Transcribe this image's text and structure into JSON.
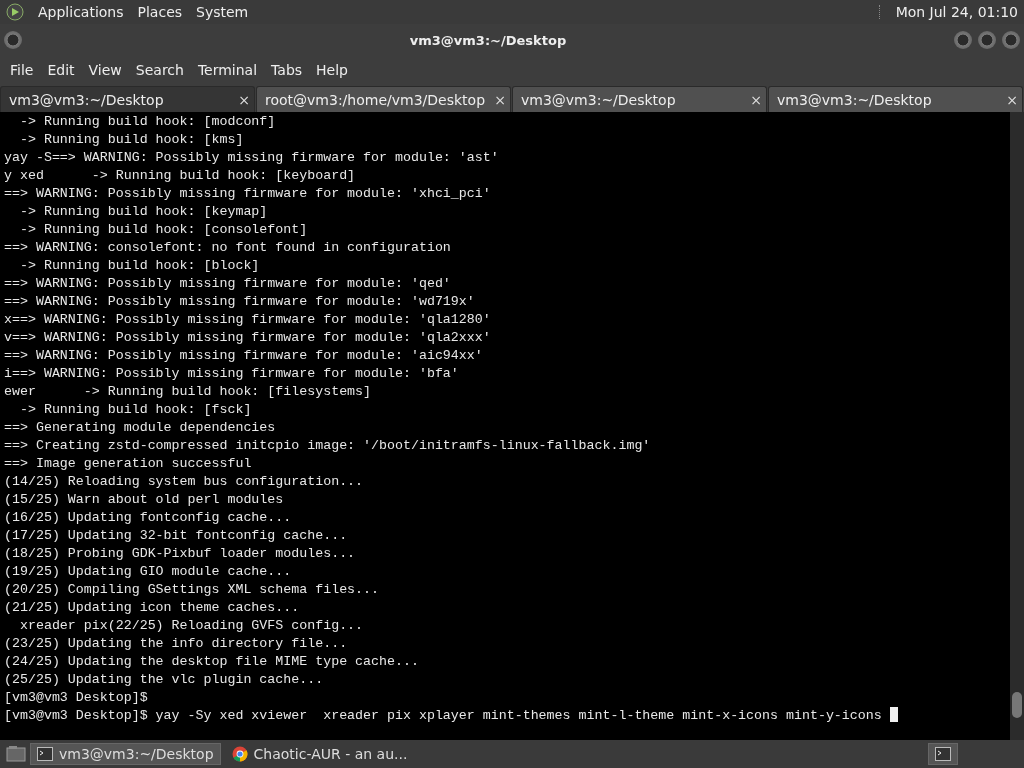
{
  "top_panel": {
    "menus": [
      "Applications",
      "Places",
      "System"
    ],
    "clock": "Mon Jul 24, 01:10"
  },
  "window": {
    "title": "vm3@vm3:~/Desktop"
  },
  "menu_bar": [
    "File",
    "Edit",
    "View",
    "Search",
    "Terminal",
    "Tabs",
    "Help"
  ],
  "tabs": [
    {
      "label": "vm3@vm3:~/Desktop",
      "close": "×",
      "selected": true
    },
    {
      "label": "root@vm3:/home/vm3/Desktop",
      "close": "×",
      "selected": false
    },
    {
      "label": "vm3@vm3:~/Desktop",
      "close": "×",
      "selected": false
    },
    {
      "label": "vm3@vm3:~/Desktop",
      "close": "×",
      "selected": false
    }
  ],
  "terminal": {
    "lines": [
      "  -> Running build hook: [modconf]",
      "  -> Running build hook: [kms]",
      "yay -S==> WARNING: Possibly missing firmware for module: 'ast'",
      "y xed      -> Running build hook: [keyboard]",
      "==> WARNING: Possibly missing firmware for module: 'xhci_pci'",
      "  -> Running build hook: [keymap]",
      "  -> Running build hook: [consolefont]",
      "==> WARNING: consolefont: no font found in configuration",
      "  -> Running build hook: [block]",
      "==> WARNING: Possibly missing firmware for module: 'qed'",
      "==> WARNING: Possibly missing firmware for module: 'wd719x'",
      "x==> WARNING: Possibly missing firmware for module: 'qla1280'",
      "v==> WARNING: Possibly missing firmware for module: 'qla2xxx'",
      "==> WARNING: Possibly missing firmware for module: 'aic94xx'",
      "i==> WARNING: Possibly missing firmware for module: 'bfa'",
      "ewer      -> Running build hook: [filesystems]",
      "  -> Running build hook: [fsck]",
      "==> Generating module dependencies",
      "==> Creating zstd-compressed initcpio image: '/boot/initramfs-linux-fallback.img'",
      "==> Image generation successful",
      "(14/25) Reloading system bus configuration...",
      "(15/25) Warn about old perl modules",
      "(16/25) Updating fontconfig cache...",
      "(17/25) Updating 32-bit fontconfig cache...",
      "(18/25) Probing GDK-Pixbuf loader modules...",
      "(19/25) Updating GIO module cache...",
      "(20/25) Compiling GSettings XML schema files...",
      "(21/25) Updating icon theme caches...",
      "  xreader pix(22/25) Reloading GVFS config...",
      "(23/25) Updating the info directory file...",
      "(24/25) Updating the desktop file MIME type cache...",
      "(25/25) Updating the vlc plugin cache...",
      "[vm3@vm3 Desktop]$"
    ],
    "command_line": "[vm3@vm3 Desktop]$ yay -Sy xed xviewer  xreader pix xplayer mint-themes mint-l-theme mint-x-icons mint-y-icons "
  },
  "taskbar": {
    "tasks": [
      {
        "label": "vm3@vm3:~/Desktop",
        "kind": "terminal",
        "selected": true
      },
      {
        "label": "Chaotic-AUR - an au...",
        "kind": "browser",
        "selected": false
      }
    ]
  }
}
